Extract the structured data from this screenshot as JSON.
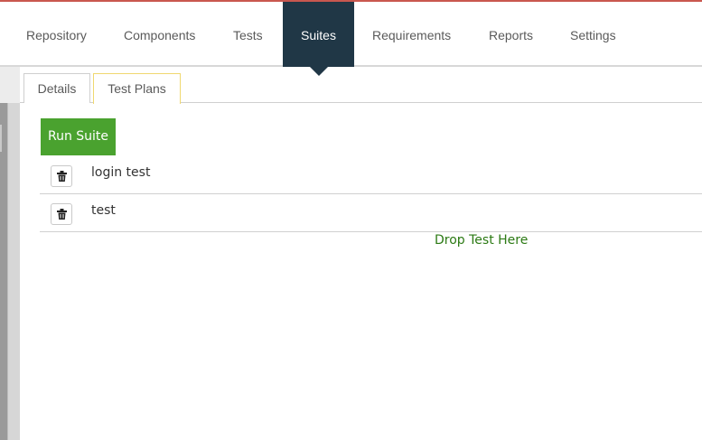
{
  "nav": {
    "items": [
      {
        "label": "Repository"
      },
      {
        "label": "Components"
      },
      {
        "label": "Tests"
      },
      {
        "label": "Suites"
      },
      {
        "label": "Requirements"
      },
      {
        "label": "Reports"
      },
      {
        "label": "Settings"
      }
    ],
    "active": "Suites"
  },
  "tabs": [
    {
      "label": "Details"
    },
    {
      "label": "Test Plans"
    }
  ],
  "active_tab": "Test Plans",
  "actions": {
    "run_label": "Run Suite"
  },
  "plans": [
    {
      "name": "login test"
    },
    {
      "name": "test"
    }
  ],
  "drop_zone": {
    "label": "Drop Test Here"
  },
  "colors": {
    "nav_active_bg": "#203746",
    "run_button_bg": "#4aa22f",
    "drop_text": "#2c7a14",
    "active_tab_border": "#f0d870"
  },
  "icons": {
    "delete": "trash-icon"
  }
}
